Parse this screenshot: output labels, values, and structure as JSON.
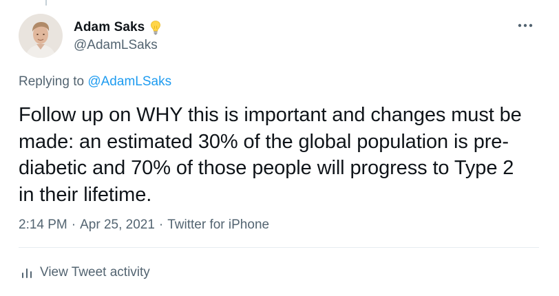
{
  "author": {
    "display_name": "Adam Saks",
    "handle": "@AdamLSaks",
    "badge_icon": "lightbulb-icon"
  },
  "reply": {
    "prefix": "Replying to ",
    "mention": "@AdamLSaks"
  },
  "tweet": {
    "text": "Follow up on WHY this is important and changes must be made: an estimated 30% of the global population is pre-diabetic and 70% of those people will progress to Type 2 in their lifetime."
  },
  "meta": {
    "time": "2:14 PM",
    "date": "Apr 25, 2021",
    "source": "Twitter for iPhone",
    "separator": "·"
  },
  "actions": {
    "activity_label": "View Tweet activity",
    "activity_icon": "bar-chart-icon",
    "more_icon": "more-horizontal-icon"
  },
  "colors": {
    "text_primary": "#0f1419",
    "text_secondary": "#536471",
    "link": "#1d9bf0",
    "divider": "#e6ecf0"
  }
}
